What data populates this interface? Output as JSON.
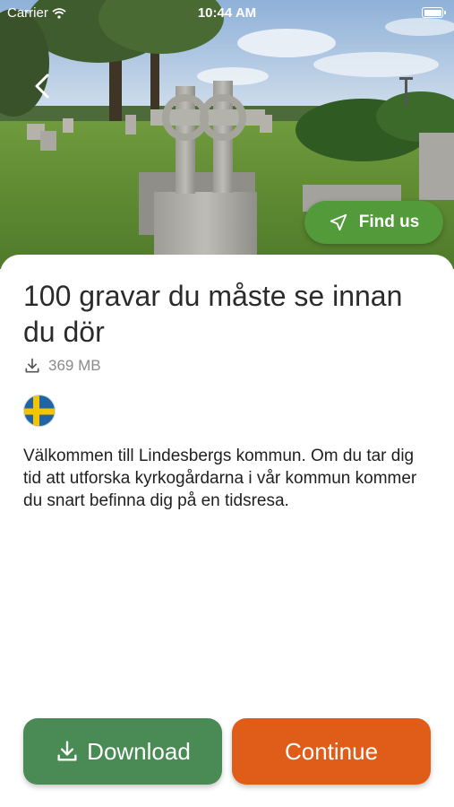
{
  "status_bar": {
    "carrier": "Carrier",
    "time": "10:44 AM"
  },
  "hero": {
    "image": "cemetery-celtic-cross-photo"
  },
  "nav": {
    "back_icon": "chevron-left-icon"
  },
  "find_us": {
    "label": "Find us",
    "icon": "navigation-arrow-icon"
  },
  "guide": {
    "title": "100 gravar du måste se innan du dör",
    "size": "369 MB",
    "size_icon": "download-icon",
    "language_flag": "swedish-flag-icon",
    "description": "Välkommen till Lindesbergs kommun. Om du tar dig tid att utforska kyrkogårdarna i vår kommun kommer du snart befinna dig på en tidsresa."
  },
  "actions": {
    "download_label": "Download",
    "continue_label": "Continue"
  },
  "colors": {
    "find_us_bg": "#529a3a",
    "download_bg": "#4a8a55",
    "continue_bg": "#e05d19",
    "flag_blue": "#1f63a8",
    "flag_yellow": "#f2c500"
  }
}
